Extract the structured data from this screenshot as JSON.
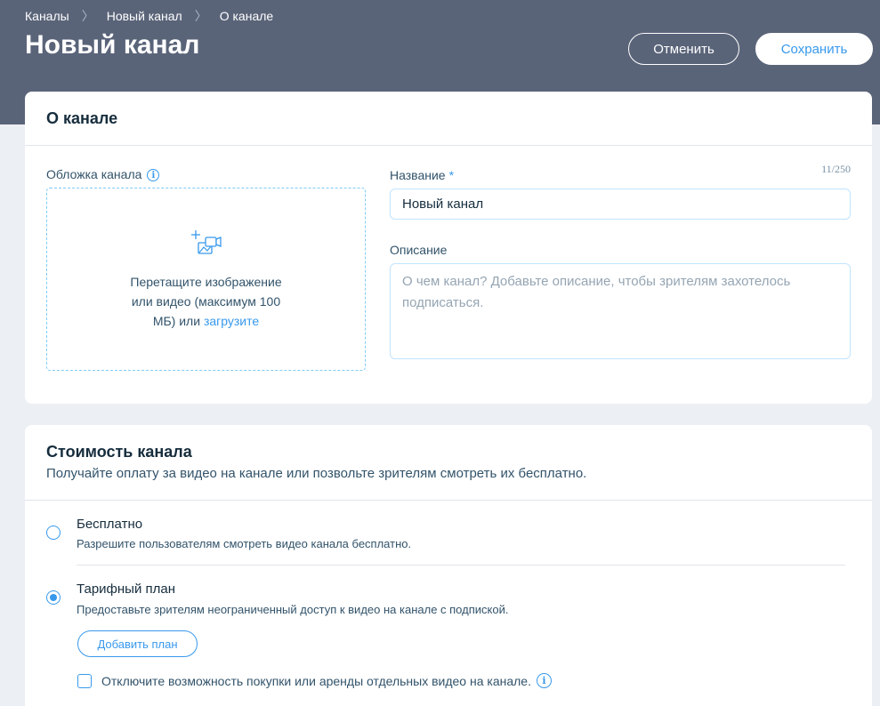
{
  "breadcrumb": {
    "items": [
      "Каналы",
      "Новый канал",
      "О канале"
    ]
  },
  "header": {
    "title": "Новый канал",
    "cancel_label": "Отменить",
    "save_label": "Сохранить"
  },
  "about": {
    "title": "О канале",
    "cover_label": "Обложка канала",
    "drop_text": "Перетащите изображение или видео (максимум 100 МБ) или",
    "drop_link": "загрузите",
    "name_label": "Название",
    "name_required": "*",
    "name_counter": "11/250",
    "name_value": "Новый канал",
    "description_label": "Описание",
    "description_placeholder": "О чем канал? Добавьте описание, чтобы зрителям захотелось подписаться."
  },
  "pricing": {
    "title": "Стоимость канала",
    "subtitle": "Получайте оплату за видео на канале или позвольте зрителям смотреть их бесплатно.",
    "options": [
      {
        "title": "Бесплатно",
        "description": "Разрешите пользователям смотреть видео канала бесплатно.",
        "selected": false
      },
      {
        "title": "Тарифный план",
        "description": "Предоставьте зрителям неограниченный доступ к видео на канале с подпиской.",
        "selected": true
      }
    ],
    "add_plan_label": "Добавить план",
    "disable_purchase_label": "Отключите возможность покупки или аренды отдельных видео на канале.",
    "disable_purchase_checked": false
  },
  "colors": {
    "header_bg": "#5a6479",
    "accent": "#3899ec",
    "page_bg": "#eceff3"
  }
}
